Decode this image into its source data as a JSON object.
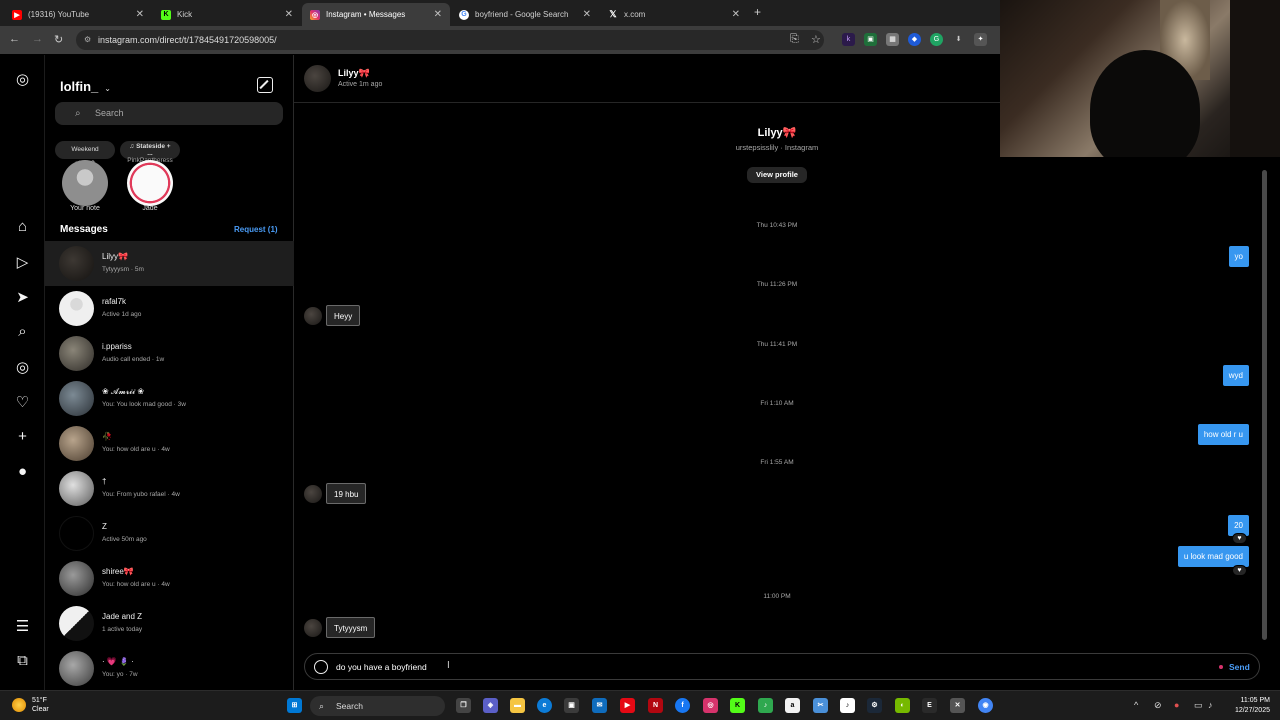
{
  "browser": {
    "tabs": [
      {
        "title": "(19316) YouTube",
        "icon": "youtube-icon",
        "color": "#ff0000"
      },
      {
        "title": "Kick",
        "icon": "kick-icon",
        "color": "#53fc18"
      },
      {
        "title": "Instagram • Messages",
        "icon": "instagram-icon",
        "color": "#e1306c",
        "active": true
      },
      {
        "title": "boyfriend - Google Search",
        "icon": "google-icon",
        "color": "#4285f4"
      },
      {
        "title": "x.com",
        "icon": "x-icon",
        "color": "#000000"
      }
    ],
    "url": "instagram.com/direct/t/17845491720598005/"
  },
  "inbox": {
    "username": "lolfin_",
    "search_placeholder": "Search",
    "notes": [
      {
        "bubble": "Weekend plans?",
        "label": "Your note"
      },
      {
        "bubble": "♫ Stateside + ...",
        "bubble_sub": "PinkPantheress",
        "label": "Jade"
      }
    ],
    "messages_heading": "Messages",
    "requests_label": "Request (1)",
    "conversations": [
      {
        "name": "Lilyy🎀",
        "sub": "Tytyyysm · 5m",
        "active": true
      },
      {
        "name": "rafal7k",
        "sub": "Active 1d ago"
      },
      {
        "name": "i.ppariss",
        "sub": "Audio call ended · 1w"
      },
      {
        "name": "❀ 𝓐𝓶𝓻𝓲𝓲 ❀",
        "sub": "You: You look mad good · 3w"
      },
      {
        "name": "🥀",
        "sub": "You: how old are u · 4w"
      },
      {
        "name": "†",
        "sub": "You: From yubo rafael · 4w"
      },
      {
        "name": "Z",
        "sub": "Active 50m ago"
      },
      {
        "name": "shiree🎀",
        "sub": "You: how old are u · 4w"
      },
      {
        "name": "Jade and Z",
        "sub": "1 active today"
      },
      {
        "name": "· 💗 🪻 ·",
        "sub": "You: yo · 7w"
      }
    ]
  },
  "chat": {
    "header_name": "Lilyy🎀",
    "header_status": "Active 1m ago",
    "profile_name": "Lilyy🎀",
    "profile_sub": "urstepsisslily · Instagram",
    "view_profile": "View profile",
    "timestamps": [
      "Thu 10:43 PM",
      "Thu 11:26 PM",
      "Thu 11:41 PM",
      "Fri 1:10 AM",
      "Fri 1:55 AM",
      "11:00 PM"
    ],
    "messages": [
      {
        "from": "me",
        "text": "yo"
      },
      {
        "from": "them",
        "text": "Heyy"
      },
      {
        "from": "me",
        "text": "wyd"
      },
      {
        "from": "me",
        "text": "how old r u"
      },
      {
        "from": "them",
        "text": "19 hbu"
      },
      {
        "from": "me",
        "text": "20",
        "reaction": "♥"
      },
      {
        "from": "me",
        "text": "u look mad good",
        "reaction": "♥"
      },
      {
        "from": "them",
        "text": "Tytyyysm"
      }
    ],
    "composer_text": "do you have a boyfriend",
    "send_label": "Send"
  },
  "taskbar": {
    "weather_temp": "51°F",
    "weather_desc": "Clear",
    "search_label": "Search",
    "time": "11:05 PM",
    "date": "12/27/2025"
  }
}
